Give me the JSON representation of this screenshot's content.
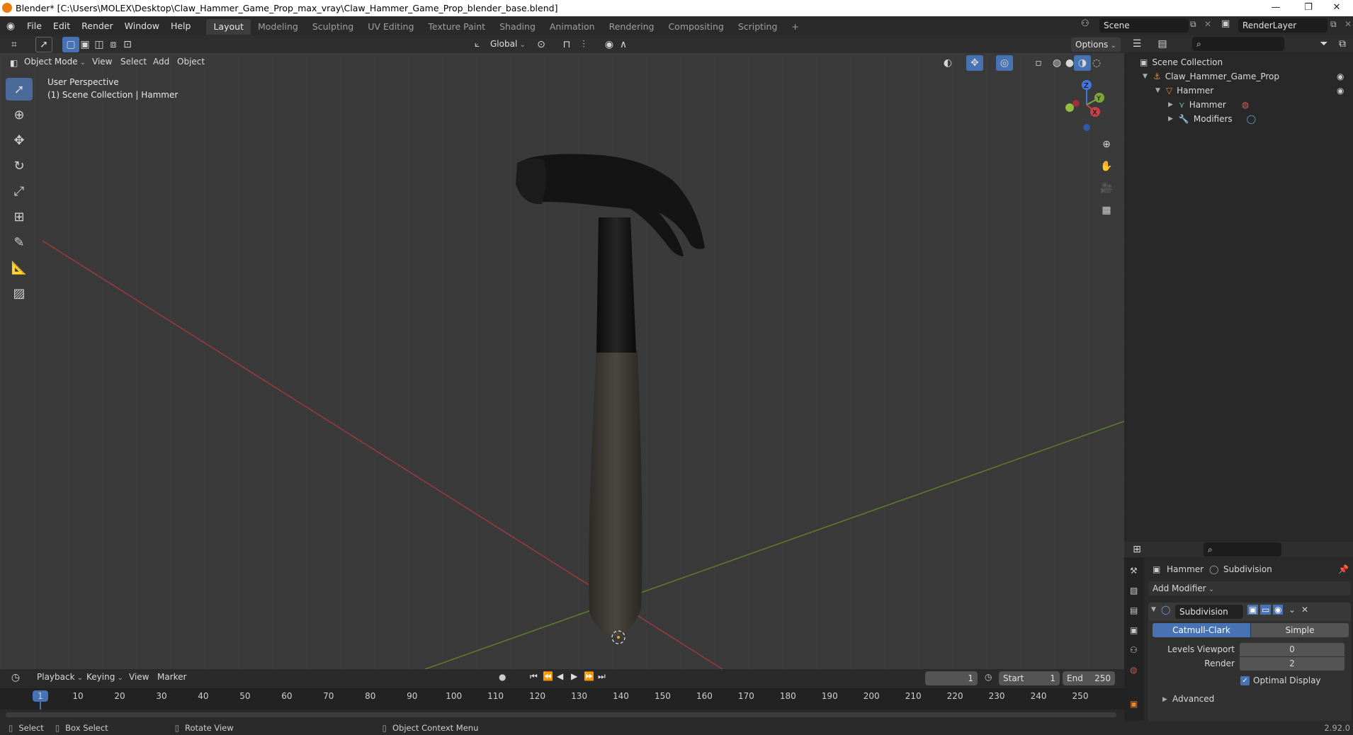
{
  "window": {
    "title": "Blender* [C:\\Users\\MOLEX\\Desktop\\Claw_Hammer_Game_Prop_max_vray\\Claw_Hammer_Game_Prop_blender_base.blend]",
    "minimize": "—",
    "maximize": "❐",
    "close": "✕"
  },
  "menus": [
    "File",
    "Edit",
    "Render",
    "Window",
    "Help"
  ],
  "workspaces": [
    "Layout",
    "Modeling",
    "Sculpting",
    "UV Editing",
    "Texture Paint",
    "Shading",
    "Animation",
    "Rendering",
    "Compositing",
    "Scripting"
  ],
  "workspace_add": "+",
  "scene": {
    "name": "Scene",
    "render_layer": "RenderLayer"
  },
  "viewport_header": {
    "transform_orientation": "Global",
    "options": "Options",
    "mode": "Object Mode",
    "menus": [
      "View",
      "Select",
      "Add",
      "Object"
    ]
  },
  "viewport": {
    "perspective": "User Perspective",
    "collection_info": "(1) Scene Collection | Hammer",
    "gizmo": {
      "x": "X",
      "y": "Y",
      "z": "Z"
    }
  },
  "outliner": {
    "root": "Scene Collection",
    "items": [
      {
        "label": "Claw_Hammer_Game_Prop",
        "level": 1
      },
      {
        "label": "Hammer",
        "level": 2
      },
      {
        "label": "Hammer",
        "level": 3
      },
      {
        "label": "Modifiers",
        "level": 3
      }
    ]
  },
  "properties": {
    "object_name": "Hammer",
    "modifier_breadcrumb": "Subdivision",
    "add_modifier": "Add Modifier",
    "modifier": {
      "name": "Subdivision",
      "tab_active": "Catmull-Clark",
      "tab_other": "Simple",
      "levels_viewport_label": "Levels Viewport",
      "levels_viewport": "0",
      "render_label": "Render",
      "render": "2",
      "optimal_display_label": "Optimal Display",
      "advanced_label": "Advanced"
    }
  },
  "timeline": {
    "menus": [
      "Playback",
      "Keying",
      "View",
      "Marker"
    ],
    "current_frame": "1",
    "start_label": "Start",
    "start": "1",
    "end_label": "End",
    "end": "250",
    "ticks": [
      "1",
      "10",
      "20",
      "30",
      "40",
      "50",
      "60",
      "70",
      "80",
      "90",
      "100",
      "110",
      "120",
      "130",
      "140",
      "150",
      "160",
      "170",
      "180",
      "190",
      "200",
      "210",
      "220",
      "230",
      "240",
      "250"
    ]
  },
  "statusbar": {
    "select": "Select",
    "box_select": "Box Select",
    "rotate_view": "Rotate View",
    "context_menu": "Object Context Menu",
    "version": "2.92.0"
  },
  "colors": {
    "accent": "#4772b3",
    "active_frame": "#4772b3",
    "x_axis": "#b8353e",
    "y_axis": "#6b8e23",
    "viewport_bg": "#3a3a3a"
  }
}
